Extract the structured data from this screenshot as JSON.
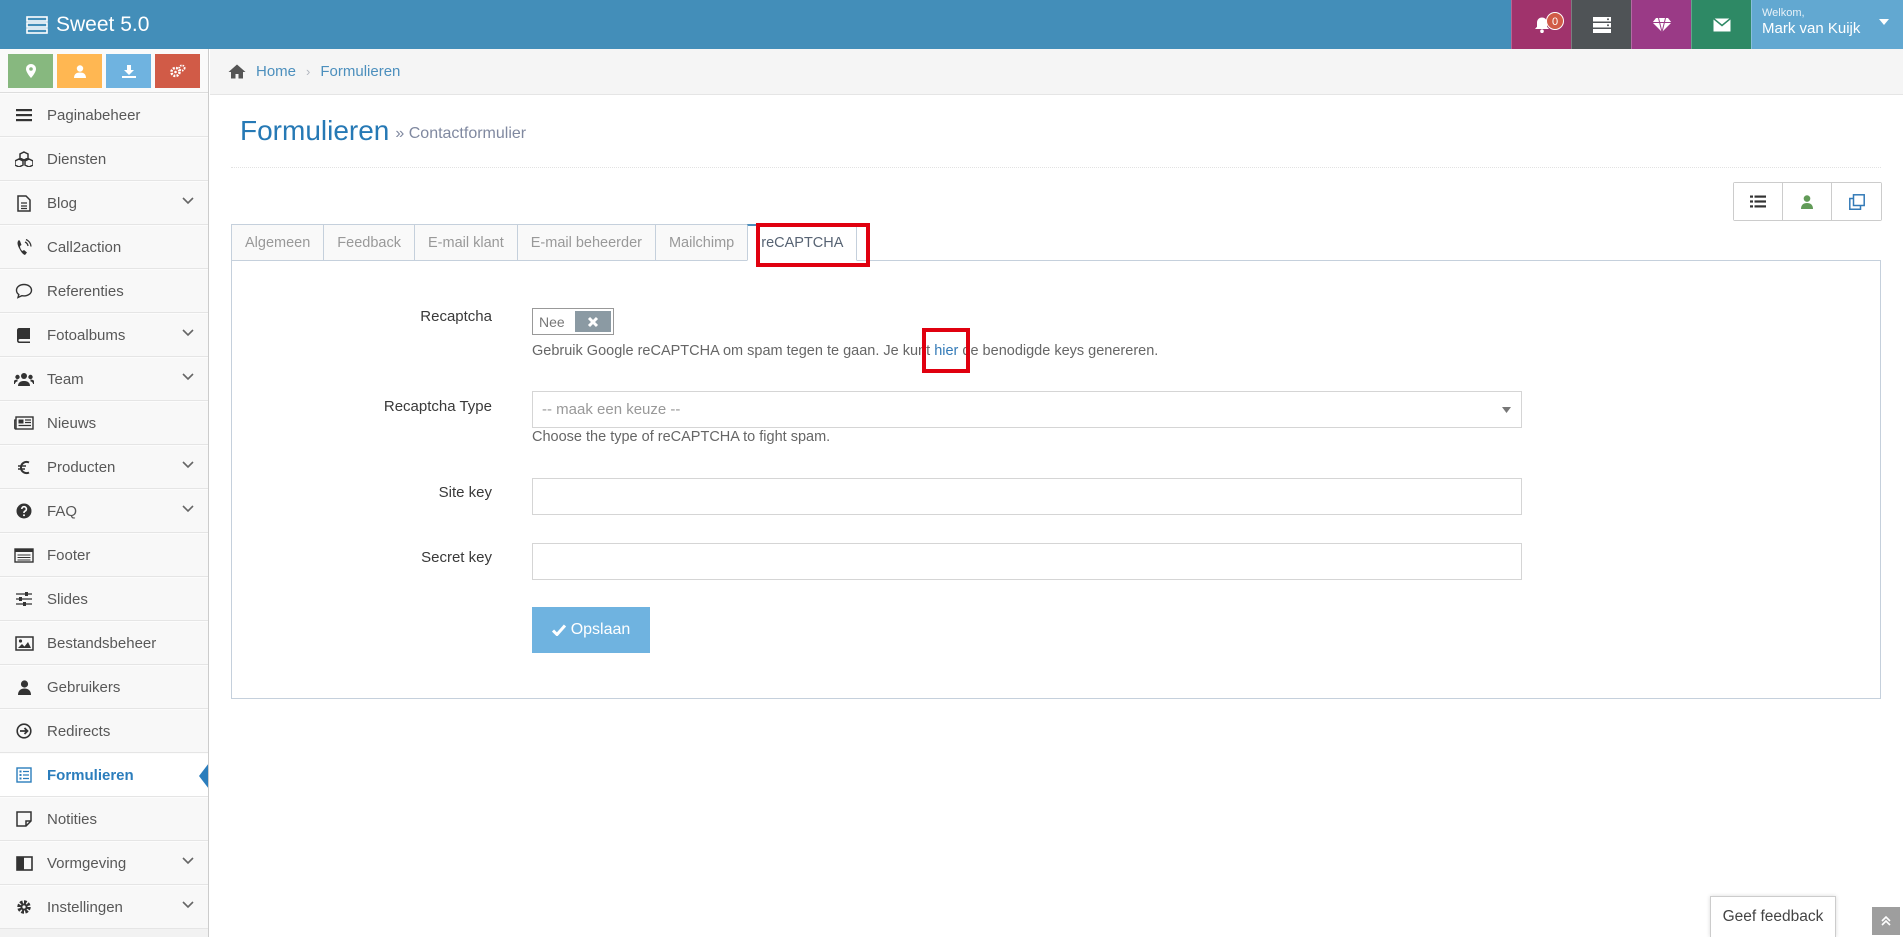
{
  "app": {
    "title": "Sweet 5.0"
  },
  "navbar": {
    "notification_count": "0",
    "welcome": "Welkom,",
    "user_name": "Mark van Kuijk",
    "colors": {
      "bar": "#438eb9",
      "notifications": "#a0336c",
      "tasks": "#4f5356",
      "premium": "#9a3a86",
      "messages": "#2e8965",
      "user": "#62a8d1"
    }
  },
  "shortcuts": [
    {
      "icon": "map-marker-icon",
      "color": "#87b87f"
    },
    {
      "icon": "user-icon",
      "color": "#ffb752"
    },
    {
      "icon": "download-icon",
      "color": "#6fb3e0"
    },
    {
      "icon": "cogs-icon",
      "color": "#d15b47"
    }
  ],
  "sidebar": {
    "items": [
      {
        "label": "Paginabeheer",
        "icon": "bars-icon",
        "has_submenu": false
      },
      {
        "label": "Diensten",
        "icon": "cubes-icon",
        "has_submenu": false
      },
      {
        "label": "Blog",
        "icon": "file-text-icon",
        "has_submenu": true
      },
      {
        "label": "Call2action",
        "icon": "phone-volume-icon",
        "has_submenu": false
      },
      {
        "label": "Referenties",
        "icon": "comment-icon",
        "has_submenu": false
      },
      {
        "label": "Fotoalbums",
        "icon": "book-icon",
        "has_submenu": true
      },
      {
        "label": "Team",
        "icon": "users-icon",
        "has_submenu": true
      },
      {
        "label": "Nieuws",
        "icon": "newspaper-icon",
        "has_submenu": false
      },
      {
        "label": "Producten",
        "icon": "euro-icon",
        "has_submenu": true
      },
      {
        "label": "FAQ",
        "icon": "question-circle-icon",
        "has_submenu": true
      },
      {
        "label": "Footer",
        "icon": "list-alt-icon",
        "has_submenu": false
      },
      {
        "label": "Slides",
        "icon": "sliders-icon",
        "has_submenu": false
      },
      {
        "label": "Bestandsbeheer",
        "icon": "image-icon",
        "has_submenu": false
      },
      {
        "label": "Gebruikers",
        "icon": "user-icon",
        "has_submenu": false
      },
      {
        "label": "Redirects",
        "icon": "arrow-circle-right-icon",
        "has_submenu": false
      },
      {
        "label": "Formulieren",
        "icon": "form-icon",
        "has_submenu": false,
        "active": true
      },
      {
        "label": "Notities",
        "icon": "sticky-note-icon",
        "has_submenu": false
      },
      {
        "label": "Vormgeving",
        "icon": "columns-icon",
        "has_submenu": true
      },
      {
        "label": "Instellingen",
        "icon": "gear-icon",
        "has_submenu": true
      }
    ]
  },
  "breadcrumb": {
    "home": "Home",
    "current": "Formulieren"
  },
  "page": {
    "title": "Formulieren",
    "subtitle": "» Contactformulier"
  },
  "tabs": [
    {
      "label": "Algemeen"
    },
    {
      "label": "Feedback"
    },
    {
      "label": "E-mail klant"
    },
    {
      "label": "E-mail beheerder"
    },
    {
      "label": "Mailchimp"
    },
    {
      "label": "reCAPTCHA",
      "active": true
    }
  ],
  "form": {
    "recaptcha": {
      "label": "Recaptcha",
      "toggle_value": "Nee",
      "help_before": "Gebruik Google reCAPTCHA om spam tegen te gaan. Je kunt ",
      "help_link": "hier",
      "help_after": " de benodigde keys genereren."
    },
    "recaptcha_type": {
      "label": "Recaptcha Type",
      "selected": "-- maak een keuze --",
      "help": "Choose the type of reCAPTCHA to fight spam."
    },
    "site_key": {
      "label": "Site key",
      "value": ""
    },
    "secret_key": {
      "label": "Secret key",
      "value": ""
    },
    "save_label": "Opslaan"
  },
  "feedback_label": "Geef feedback"
}
